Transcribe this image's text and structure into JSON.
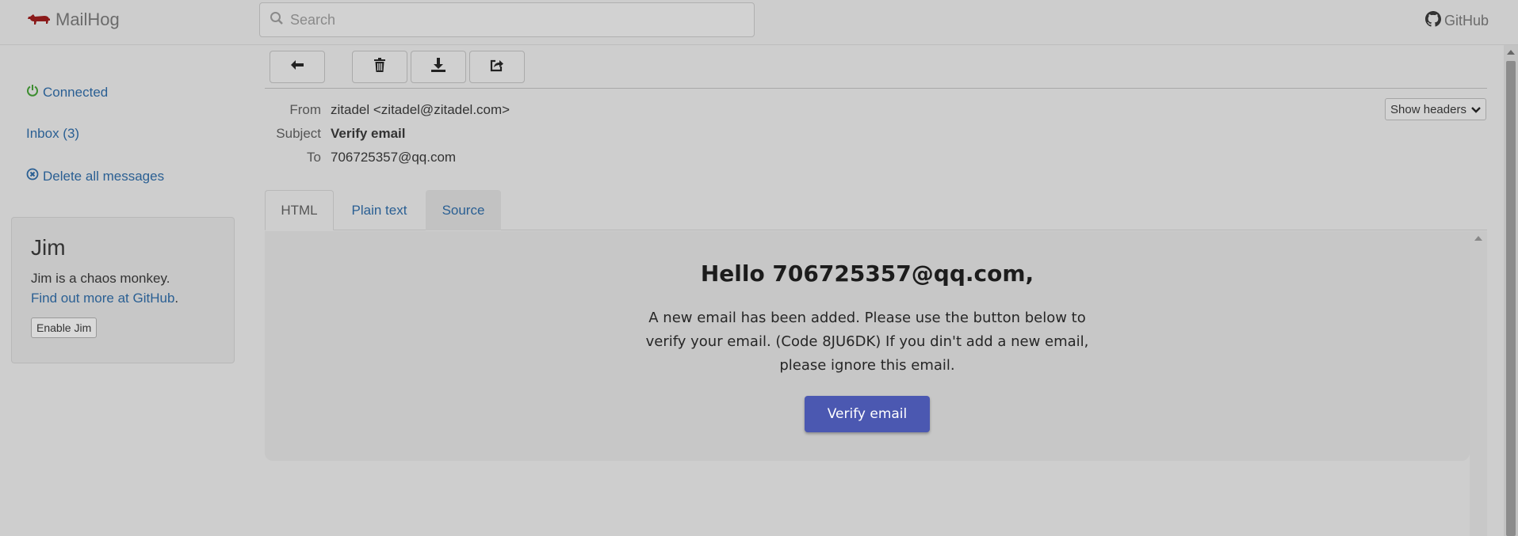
{
  "app": {
    "name": "MailHog",
    "github_label": "GitHub"
  },
  "search": {
    "placeholder": "Search",
    "value": ""
  },
  "sidebar": {
    "connected": "Connected",
    "inbox": "Inbox (3)",
    "delete_all": "Delete all messages"
  },
  "jim": {
    "title": "Jim",
    "description": "Jim is a chaos monkey.",
    "link": "Find out more at GitHub",
    "link_suffix": ".",
    "button": "Enable Jim"
  },
  "message": {
    "from_label": "From",
    "from": "zitadel <zitadel@zitadel.com>",
    "subject_label": "Subject",
    "subject": "Verify email",
    "to_label": "To",
    "to": "706725357@qq.com",
    "show_headers": "Show headers"
  },
  "tabs": {
    "html": "HTML",
    "plain": "Plain text",
    "source": "Source"
  },
  "email": {
    "heading": "Hello 706725357@qq.com,",
    "body": "A new email has been added. Please use the button below to verify your email. (Code 8JU6DK) If you din't add a new email, please ignore this email.",
    "button": "Verify email",
    "button_color": "#4b58b1"
  },
  "colors": {
    "link": "#2a5f93",
    "brand_icon": "#8b1a1a",
    "connected_icon": "#3c8d2f"
  }
}
